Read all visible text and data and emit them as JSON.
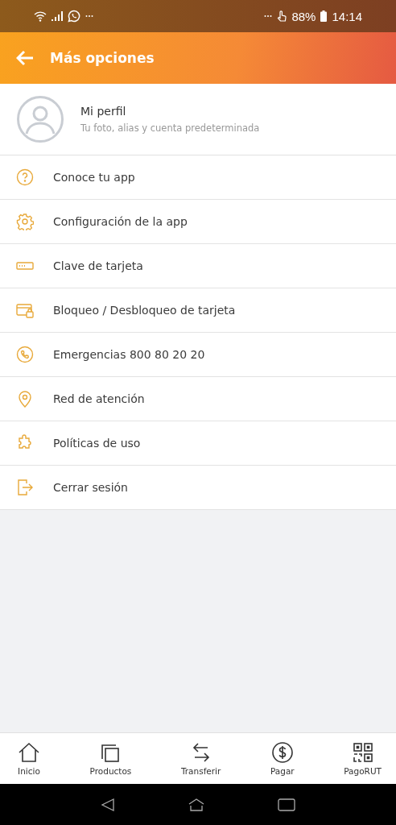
{
  "status_bar": {
    "battery": "88%",
    "time": "14:14"
  },
  "header": {
    "title": "Más opciones"
  },
  "profile": {
    "name": "Mi perfil",
    "subtitle": "Tu foto, alias y cuenta predeterminada"
  },
  "menu": [
    {
      "kind": "help",
      "label": "Conoce tu app"
    },
    {
      "kind": "settings",
      "label": "Configuración de la app"
    },
    {
      "kind": "pin",
      "label": "Clave de tarjeta"
    },
    {
      "kind": "lock",
      "label": "Bloqueo / Desbloqueo de tarjeta"
    },
    {
      "kind": "phone",
      "label": "Emergencias 800 80 20 20"
    },
    {
      "kind": "location",
      "label": "Red de atención"
    },
    {
      "kind": "puzzle",
      "label": "Políticas de uso"
    },
    {
      "kind": "logout",
      "label": "Cerrar sesión"
    }
  ],
  "bottom_nav": [
    {
      "kind": "home",
      "label": "Inicio"
    },
    {
      "kind": "products",
      "label": "Productos"
    },
    {
      "kind": "transfer",
      "label": "Transferir"
    },
    {
      "kind": "pay",
      "label": "Pagar"
    },
    {
      "kind": "qr",
      "label": "PagoRUT"
    }
  ]
}
